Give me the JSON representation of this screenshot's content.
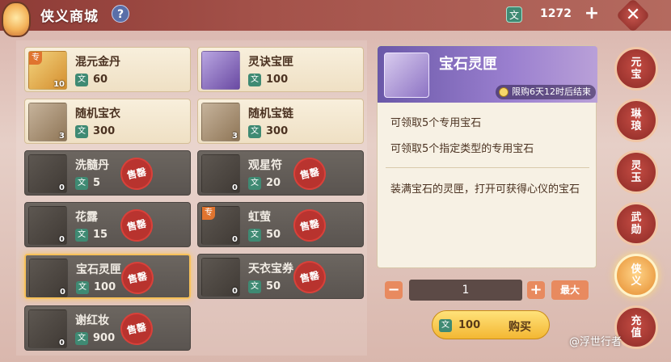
{
  "header": {
    "title": "侠义商城",
    "help_label": "?",
    "currency_icon_text": "文",
    "currency_amount": "1272",
    "add_label": "+",
    "close_label": "✕"
  },
  "shop_items": [
    {
      "name": "混元金丹",
      "price": "60",
      "count": "10",
      "tag": "专",
      "sold_out": false,
      "thumb": "gold"
    },
    {
      "name": "灵诀宝匣",
      "price": "100",
      "count": "",
      "tag": "",
      "sold_out": false,
      "thumb": "purple"
    },
    {
      "name": "随机宝衣",
      "price": "300",
      "count": "3",
      "tag": "",
      "sold_out": false,
      "thumb": "default"
    },
    {
      "name": "随机宝链",
      "price": "300",
      "count": "3",
      "tag": "",
      "sold_out": false,
      "thumb": "default"
    },
    {
      "name": "洗髓丹",
      "price": "5",
      "count": "0",
      "tag": "",
      "sold_out": true,
      "thumb": "default"
    },
    {
      "name": "观星符",
      "price": "20",
      "count": "0",
      "tag": "",
      "sold_out": true,
      "thumb": "default"
    },
    {
      "name": "花露",
      "price": "15",
      "count": "0",
      "tag": "",
      "sold_out": true,
      "thumb": "default"
    },
    {
      "name": "虹萤",
      "price": "50",
      "count": "0",
      "tag": "专",
      "sold_out": true,
      "thumb": "default"
    },
    {
      "name": "宝石灵匣",
      "price": "100",
      "count": "0",
      "tag": "",
      "sold_out": true,
      "thumb": "default",
      "selected": true
    },
    {
      "name": "天衣宝券",
      "price": "50",
      "count": "0",
      "tag": "",
      "sold_out": true,
      "thumb": "default"
    },
    {
      "name": "谢红妆",
      "price": "900",
      "count": "0",
      "tag": "",
      "sold_out": true,
      "thumb": "default"
    }
  ],
  "sold_out_label": "售罄",
  "price_icon_text": "文",
  "detail": {
    "name": "宝石灵匣",
    "limit_text": "限购6天12时后结束",
    "line1": "可领取5个专用宝石",
    "line2": "可领取5个指定类型的专用宝石",
    "line3": "装满宝石的灵匣，打开可获得心仪的宝石"
  },
  "purchase": {
    "minus_label": "−",
    "quantity": "1",
    "plus_label": "+",
    "max_label": "最大",
    "price_icon_text": "文",
    "price": "100",
    "buy_label": "购买"
  },
  "side_tabs": [
    {
      "label": "元宝",
      "active": false
    },
    {
      "label": "琳琅",
      "active": false
    },
    {
      "label": "灵玉",
      "active": false
    },
    {
      "label": "武勋",
      "active": false
    },
    {
      "label": "侠义",
      "active": true
    },
    {
      "label": "充值",
      "active": false
    }
  ],
  "watermark": "@浮世行者",
  "colors": {
    "accent_red": "#8e3b36",
    "currency_green": "#3f8a73",
    "buy_gold": "#f3b733",
    "detail_purple": "#6a58a8"
  }
}
